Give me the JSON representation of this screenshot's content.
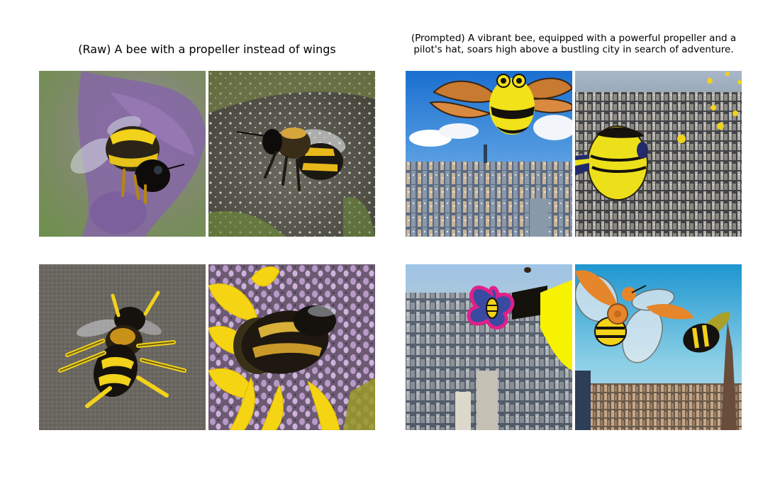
{
  "figure": {
    "left_caption": "(Raw) A bee with a propeller instead of wings",
    "right_caption": "(Prompted) A vibrant bee, equipped with a powerful propeller and a pilot's hat, soars high above a bustling city in search of adventure."
  },
  "colors": {
    "bee_yellow": "#f2d21a",
    "bee_black": "#15120e",
    "sky_blue": "#2e8fd8",
    "flower_purple": "#8b6fa6"
  }
}
